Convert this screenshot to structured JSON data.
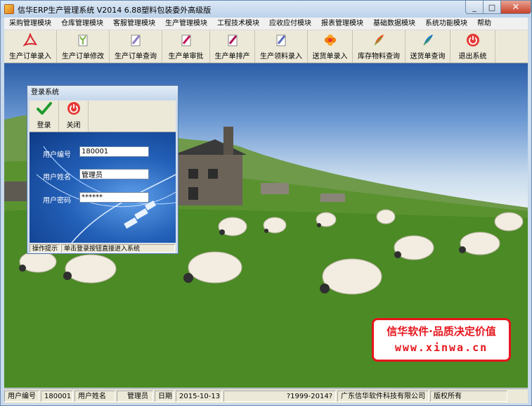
{
  "window": {
    "title": "信华ERP生产管理系统  V2014  6.88塑料包装委外高级版",
    "close_glyph": "✕",
    "minimize_glyph": "_",
    "maximize_glyph": "□"
  },
  "menu": [
    "采购管理模块",
    "仓库管理模块",
    "客服管理模块",
    "生产管理模块",
    "工程技术模块",
    "应收应付模块",
    "报表管理模块",
    "基础数据模块",
    "系统功能模块",
    "帮助"
  ],
  "toolbar": [
    {
      "label": "生产订单录入",
      "icon": "pdf-icon",
      "color": "#d7262e"
    },
    {
      "label": "生产订单修改",
      "icon": "plant-icon",
      "color": "#7cb342"
    },
    {
      "label": "生产订单查询",
      "icon": "pen-icon",
      "color": "#8e7cc3"
    },
    {
      "label": "生产单审批",
      "icon": "pen-icon",
      "color": "#c2185b"
    },
    {
      "label": "生产单排产",
      "icon": "pen-icon",
      "color": "#ad1457"
    },
    {
      "label": "生产领料录入",
      "icon": "pen-icon",
      "color": "#5e6fb8"
    },
    {
      "label": "送货单录入",
      "icon": "flower-icon",
      "color": "#f57c00"
    },
    {
      "label": "库存物料查询",
      "icon": "feather-icon",
      "color": "#e64a19"
    },
    {
      "label": "送货单查询",
      "icon": "feather-icon",
      "color": "#1976d2"
    },
    {
      "label": "退出系统",
      "icon": "power-icon",
      "color": "#e53935"
    }
  ],
  "login": {
    "title": "登录系统",
    "login_button": "登录",
    "close_button": "关闭",
    "user_id_label": "用户编号",
    "user_id_value": "180001",
    "user_name_label": "用户姓名",
    "user_name_value": "管理员",
    "password_label": "用户密码",
    "password_value": "******",
    "status_title": "操作提示",
    "status_message": "单击登录按钮直接进入系统"
  },
  "promo": {
    "line1": "信华软件·品质决定价值",
    "line2": "www.xinwa.cn"
  },
  "status": {
    "user_id_label": "用户编号",
    "user_id_value": "180001",
    "user_name_label": "用户姓名",
    "user_name_value": "管理员",
    "date_label": "日期",
    "date_value": "2015-10-13",
    "copyright": "?1999-2014?",
    "company": "广东信华软件科技有限公司",
    "rights": "版权所有"
  }
}
